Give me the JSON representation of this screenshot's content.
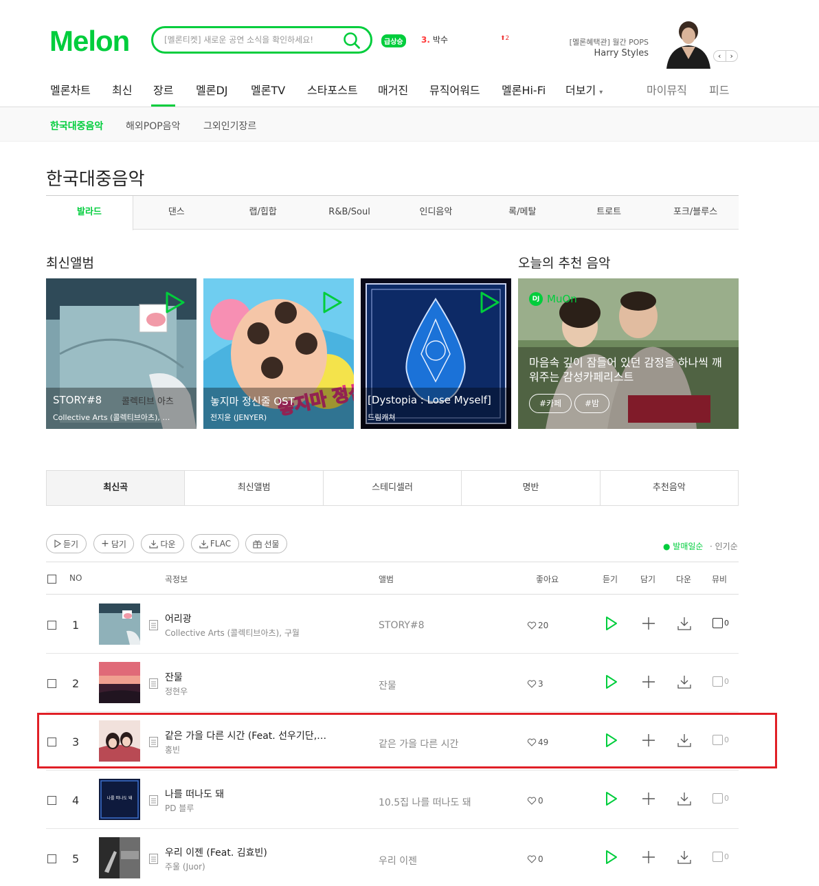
{
  "header": {
    "logo": "Melon",
    "search_placeholder": "[멜론티켓] 새로운 공연 소식을 확인하세요!",
    "hot_badge": "급상승",
    "hot_rank_num": "3.",
    "hot_rank_title": "박수",
    "hot_rank_change": "2",
    "promo_tag": "[멜론혜택관] 월간 POPS",
    "promo_title": "Harry Styles",
    "promo_prev": "‹",
    "promo_next": "›"
  },
  "gnb": {
    "items": [
      "멜론차트",
      "최신",
      "장르",
      "멜론DJ",
      "멜론TV",
      "스타포스트",
      "매거진",
      "뮤직어워드",
      "멜론Hi-Fi",
      "더보기"
    ],
    "more_arrow": "▾",
    "right_items": [
      "마이뮤직",
      "피드"
    ]
  },
  "lnb": {
    "items": [
      "한국대중음악",
      "해외POP음악",
      "그외인기장르"
    ]
  },
  "page_title": "한국대중음악",
  "genre_tabs": [
    "발라드",
    "댄스",
    "랩/힙합",
    "R&B/Soul",
    "인디음악",
    "록/메탈",
    "트로트",
    "포크/블루스"
  ],
  "sections": {
    "latest_albums": "최신앨범",
    "recommend": "오늘의 추천 음악"
  },
  "albums": [
    {
      "title": "STORY#8",
      "artist": "Collective Arts (콜렉티브아츠), …",
      "cover_text": "콜렉티브 아츠"
    },
    {
      "title": "놓지마 정신줄 OST",
      "artist": "전지윤 (JENYER)",
      "cover_text": "놓지마 정신줄!"
    },
    {
      "title": "[Dystopia : Lose Myself]",
      "artist": "드림캐쳐"
    }
  ],
  "dj": {
    "badge": "DJ",
    "brand": "MuOn",
    "description": "마음속 깊이 잠들어 있던 감정을 하나씩 깨워주는 감성카페리스트",
    "tags": [
      "#카페",
      "#밤"
    ]
  },
  "list_tabs": [
    "최신곡",
    "최신앨범",
    "스테디셀러",
    "명반",
    "추천음악"
  ],
  "actions": {
    "play": "듣기",
    "add": "담기",
    "download": "다운",
    "flac": "FLAC",
    "gift": "선물"
  },
  "sort": {
    "release": "발매일순",
    "popular": "인기순"
  },
  "table_headers": {
    "no": "NO",
    "song_info": "곡정보",
    "album": "앨범",
    "like": "좋아요",
    "play": "듣기",
    "add": "담기",
    "download": "다운",
    "mv": "뮤비"
  },
  "songs": [
    {
      "no": "1",
      "title": "어리광",
      "artist": "Collective Arts (콜렉티브아츠), 구월",
      "album": "STORY#8",
      "likes": "20",
      "mv": "0"
    },
    {
      "no": "2",
      "title": "잔물",
      "artist": "정현우",
      "album": "잔물",
      "likes": "3",
      "mv": "0"
    },
    {
      "no": "3",
      "title": "같은 가을 다른 시간 (Feat. 선우기단,…",
      "artist": "홍빈",
      "album": "같은 가을 다른 시간",
      "likes": "49",
      "mv": "0"
    },
    {
      "no": "4",
      "title": "나를 떠나도 돼",
      "artist": "PD 블루",
      "album": "10.5집 나를 떠나도 돼",
      "likes": "0",
      "mv": "0",
      "cover_text": "나를 떠나도 돼"
    },
    {
      "no": "5",
      "title": "우리 이젠 (Feat. 김효빈)",
      "artist": "주울 (Juor)",
      "album": "우리 이젠",
      "likes": "0",
      "mv": "0"
    }
  ],
  "colors": {
    "brand": "#00cd3c",
    "highlight": "#e01f26"
  }
}
